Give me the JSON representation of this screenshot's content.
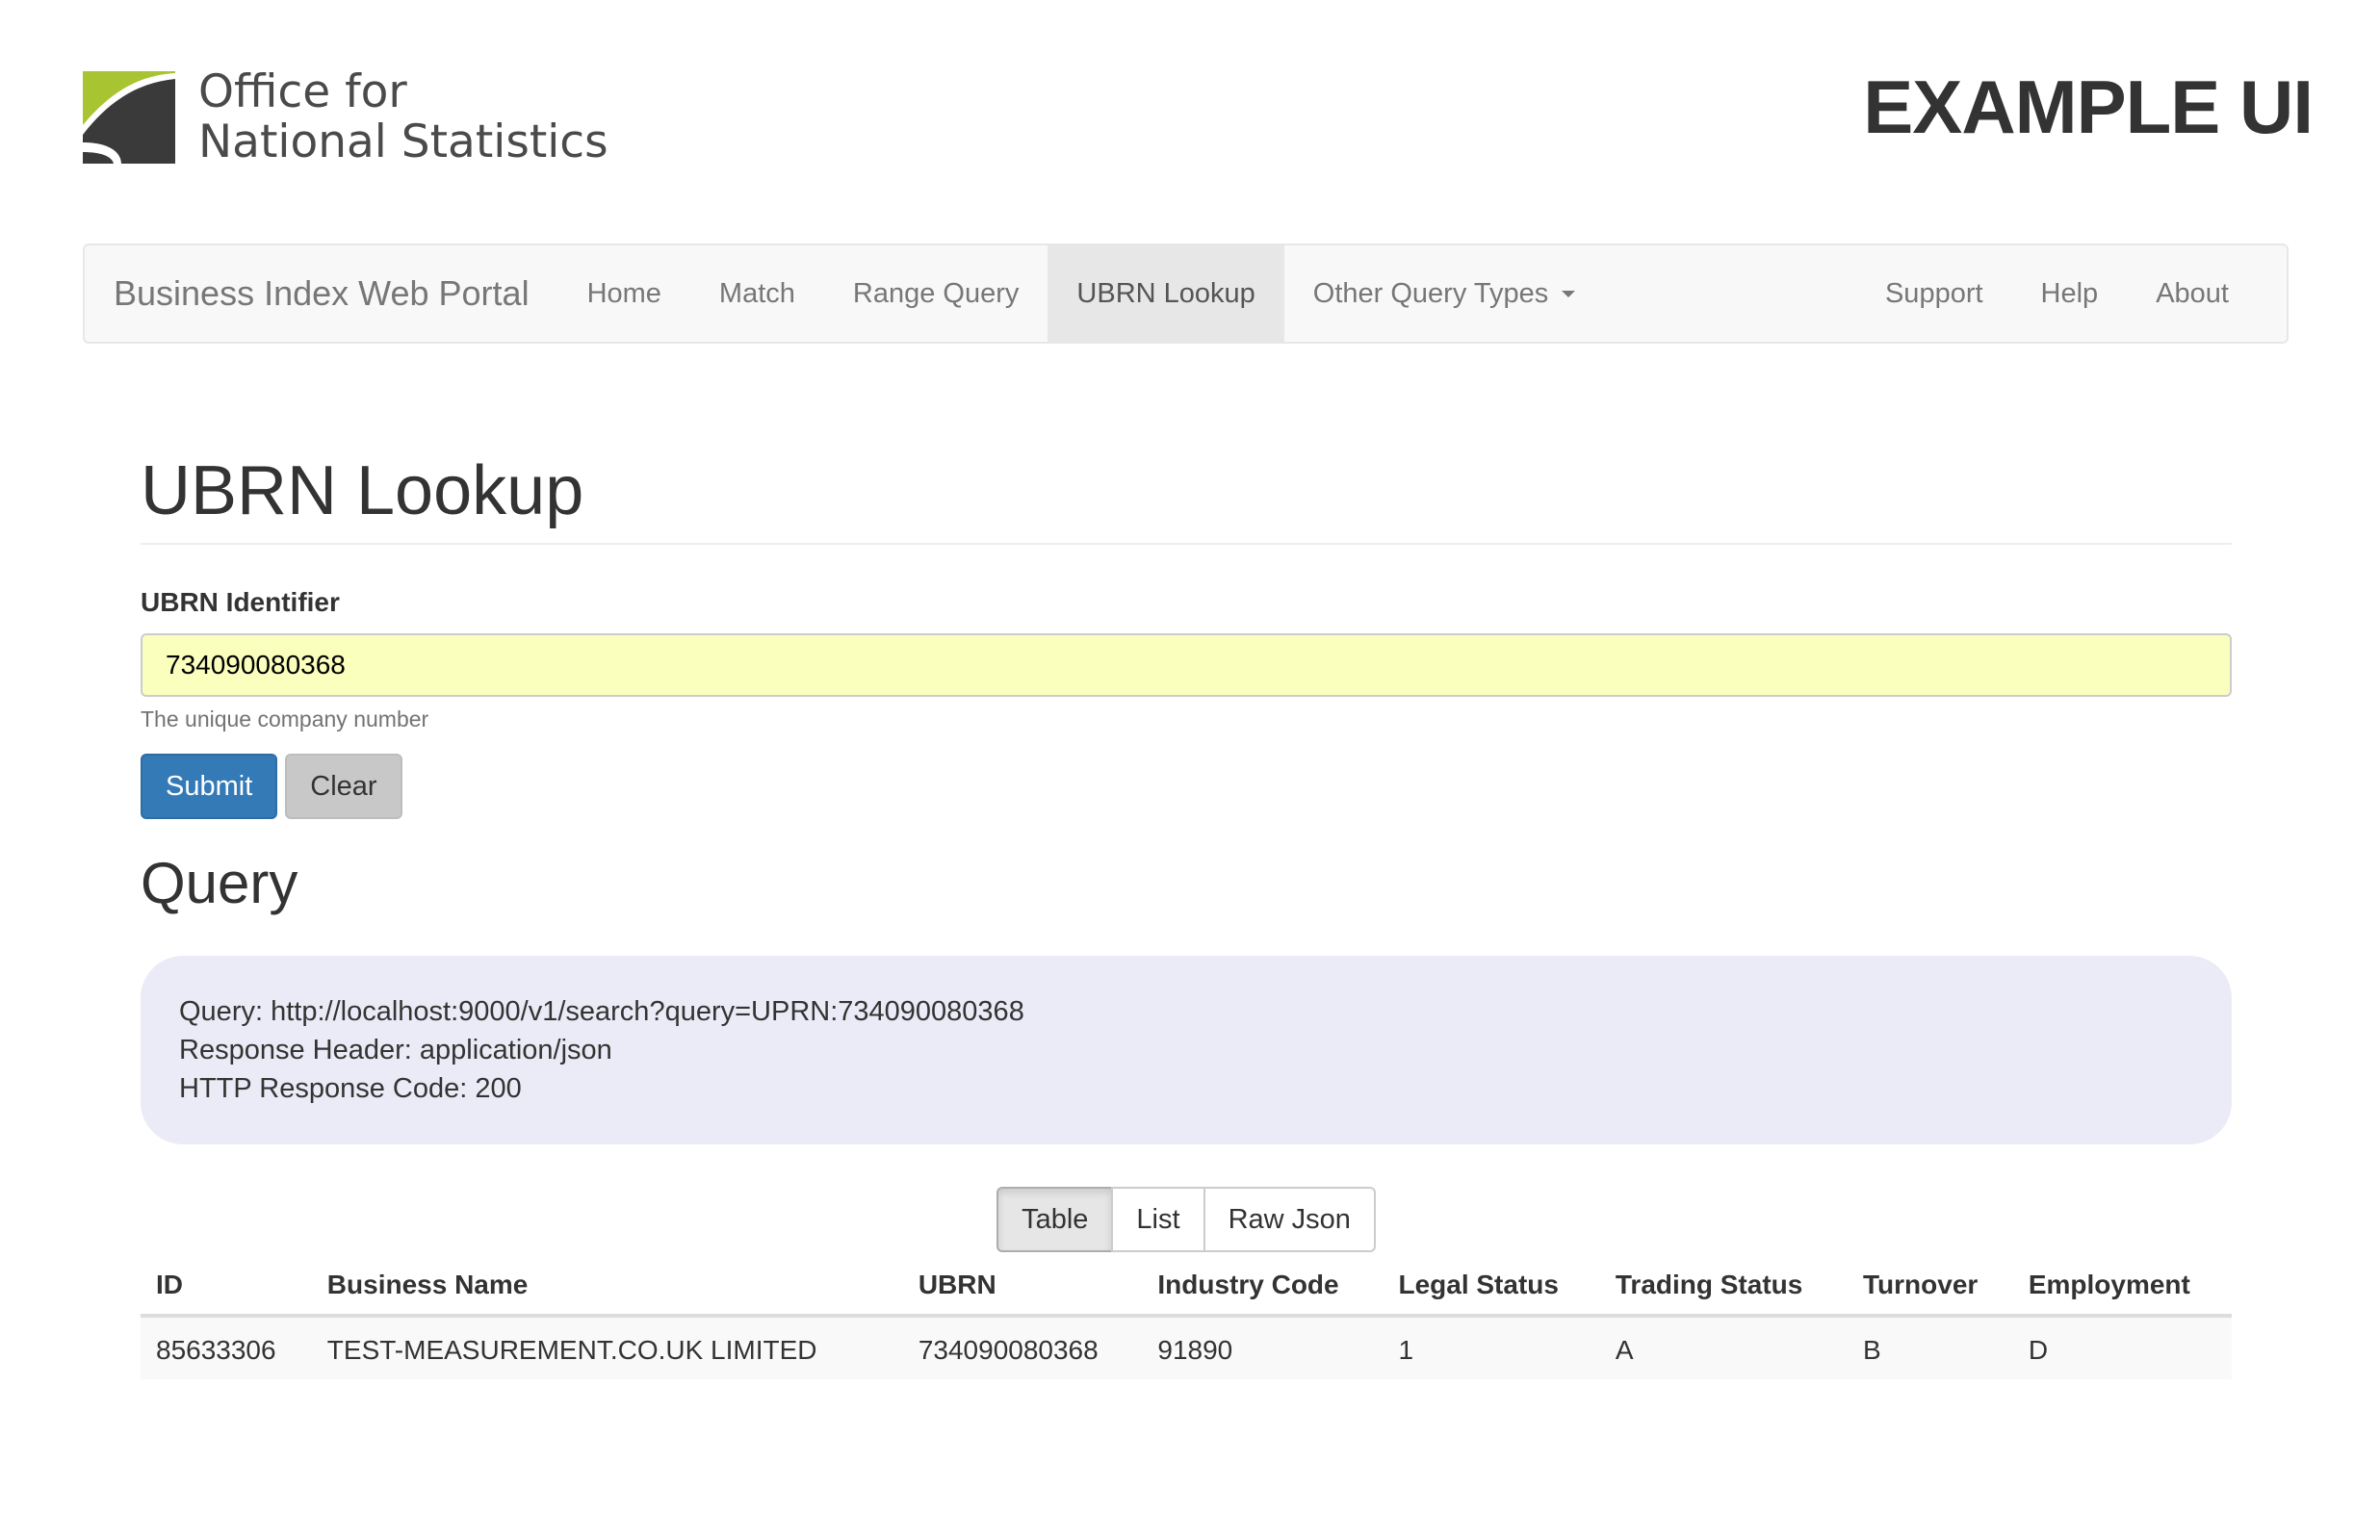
{
  "header": {
    "logo_line1": "Office for",
    "logo_line2": "National Statistics",
    "title": "EXAMPLE UI",
    "logo_colors": {
      "green": "#a8c431",
      "dark": "#3a3a3a"
    }
  },
  "navbar": {
    "brand": "Business Index Web Portal",
    "items": [
      {
        "label": "Home"
      },
      {
        "label": "Match"
      },
      {
        "label": "Range Query"
      },
      {
        "label": "UBRN Lookup",
        "active": true
      },
      {
        "label": "Other Query Types"
      }
    ],
    "right_items": [
      {
        "label": "Support"
      },
      {
        "label": "Help"
      },
      {
        "label": "About"
      }
    ]
  },
  "page": {
    "title": "UBRN Lookup",
    "field_label": "UBRN Identifier",
    "field_value": "734090080368",
    "help_text": "The unique company number",
    "submit_label": "Submit",
    "clear_label": "Clear"
  },
  "query": {
    "title": "Query",
    "line1": "Query: http://localhost:9000/v1/search?query=UPRN:734090080368",
    "line2": "Response Header: application/json",
    "line3": "HTTP Response Code: 200"
  },
  "view_toggle": {
    "options": [
      "Table",
      "List",
      "Raw Json"
    ],
    "selected": "Table"
  },
  "table": {
    "headers": [
      "ID",
      "Business Name",
      "UBRN",
      "Industry Code",
      "Legal Status",
      "Trading Status",
      "Turnover",
      "Employment"
    ],
    "rows": [
      [
        "85633306",
        "TEST-MEASUREMENT.CO.UK LIMITED",
        "734090080368",
        "91890",
        "1",
        "A",
        "B",
        "D"
      ]
    ]
  },
  "colors": {
    "primary": "#337ab7",
    "autofill": "#faffbd",
    "query_bg": "#ebebf7"
  }
}
